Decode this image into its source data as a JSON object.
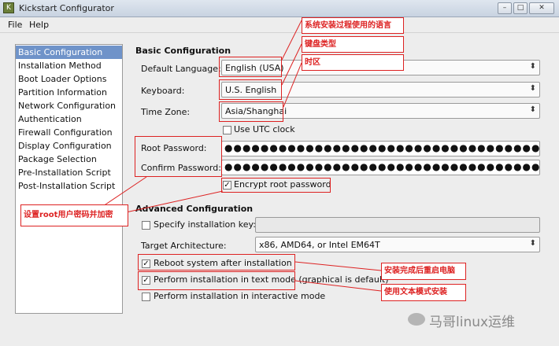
{
  "window": {
    "title": "Kickstart Configurator",
    "minimize": "–",
    "maximize": "□",
    "close": "✕"
  },
  "menu": [
    "File",
    "Help"
  ],
  "sidebar": [
    "Basic Configuration",
    "Installation Method",
    "Boot Loader Options",
    "Partition Information",
    "Network Configuration",
    "Authentication",
    "Firewall Configuration",
    "Display Configuration",
    "Package Selection",
    "Pre-Installation Script",
    "Post-Installation Script"
  ],
  "basic": {
    "heading": "Basic Configuration",
    "language_label": "Default Language:",
    "language_value": "English (USA)",
    "keyboard_label": "Keyboard:",
    "keyboard_value": "U.S. English",
    "timezone_label": "Time Zone:",
    "timezone_value": "Asia/Shanghai",
    "utc_label": "Use UTC clock",
    "root_pw_label": "Root Password:",
    "root_pw_value": "●●●●●●●●●●●●●●●●●●●●●●●●●●●●●●●●●●●●●●●●●●●●●●●●●●●●●●●●●●●●●●●●●●●●●●●●●●●●●●●●●",
    "confirm_pw_label": "Confirm Password:",
    "confirm_pw_value": "●●●●●●●●●●●●●●●●●●●●●●●●●●●●●●●●●●●●●●●●●●●●●●●●●●●●●●●●●●●●●●●●●●●●●●●●●●●●●●●●●",
    "encrypt_label": "Encrypt root password"
  },
  "advanced": {
    "heading": "Advanced Configuration",
    "key_label": "Specify installation key:",
    "arch_label": "Target Architecture:",
    "arch_value": "x86, AMD64, or Intel EM64T",
    "reboot_label": "Reboot system after installation",
    "text_mode_label": "Perform installation in text mode (graphical is default)",
    "interactive_label": "Perform installation in interactive mode"
  },
  "annotations": {
    "language": "系统安装过程使用的语言",
    "keyboard": "键盘类型",
    "timezone": "时区",
    "root_pw": "设置root用户密码并加密",
    "reboot": "安装完成后重启电脑",
    "text_mode": "使用文本模式安装"
  },
  "watermark": "马哥linux运维",
  "check_mark": "✓",
  "combo_arrow": "⬍",
  "colors": {
    "annotation": "#dd2222",
    "selection": "#6f93c9"
  }
}
